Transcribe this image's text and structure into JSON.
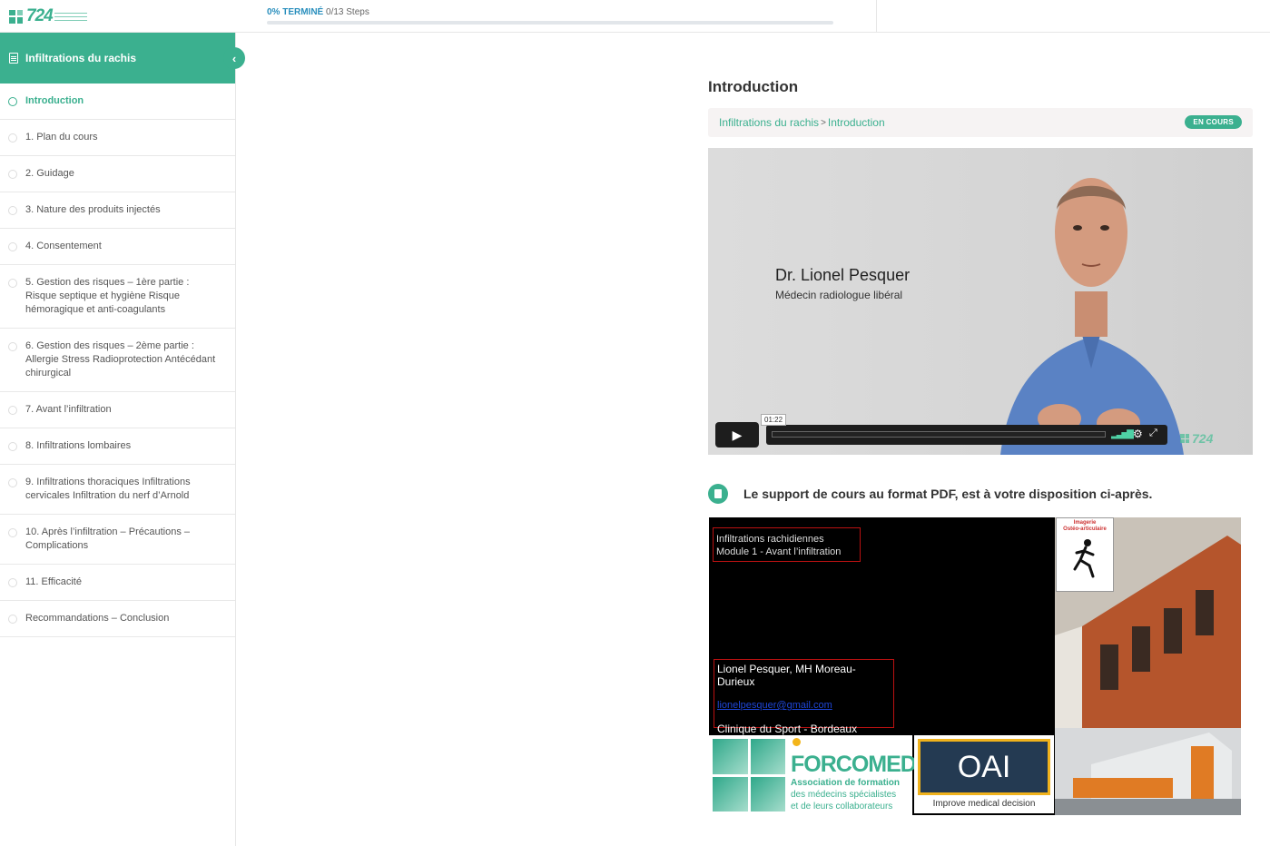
{
  "brand": {
    "logo_text": "724",
    "accent": "#3bb08f"
  },
  "progress": {
    "percent_label": "0% TERMINÉ",
    "steps_label": "0/13 Steps",
    "value": 0
  },
  "sidebar": {
    "course_title": "Infiltrations du rachis",
    "items": [
      {
        "label": "Introduction",
        "active": true
      },
      {
        "label": "1. Plan du cours"
      },
      {
        "label": "2. Guidage"
      },
      {
        "label": "3. Nature des produits injectés"
      },
      {
        "label": "4. Consentement"
      },
      {
        "label": "5. Gestion des risques – 1ère partie : Risque septique et hygiène Risque hémoragique et anti-coagulants"
      },
      {
        "label": "6. Gestion des risques – 2ème partie : Allergie Stress Radioprotection Antécédant chirurgical"
      },
      {
        "label": "7. Avant l’infiltration"
      },
      {
        "label": "8. Infiltrations lombaires"
      },
      {
        "label": "9. Infiltrations thoraciques Infiltrations cervicales Infiltration du nerf d’Arnold"
      },
      {
        "label": "10. Après l’infiltration – Précautions – Complications"
      },
      {
        "label": "11. Efficacité"
      },
      {
        "label": "Recommandations – Conclusion"
      }
    ]
  },
  "main": {
    "title": "Introduction",
    "breadcrumb": {
      "course": "Infiltrations du rachis",
      "separator": ">",
      "current": "Introduction"
    },
    "status_badge": "EN COURS",
    "video": {
      "speaker_name": "Dr. Lionel Pesquer",
      "speaker_role": "Médecin radiologue libéral",
      "time": "01:22",
      "watermark": "724"
    },
    "pdf_notice": "Le support de cours au format PDF, est à votre disposition ci-après.",
    "slide": {
      "title_line1": "Infiltrations rachidiennes",
      "title_line2": "Module 1 - Avant l’infiltration",
      "authors": "Lionel Pesquer, MH Moreau-Durieux",
      "email": "lionelpesquer@gmail.com",
      "place": "Clinique du Sport - Bordeaux",
      "imagerie_line1": "Imagerie",
      "imagerie_line2": "Ostéo-articulaire",
      "forcomed_name": "FORCOMED",
      "forcomed_sub1": "Association de formation",
      "forcomed_sub2": "des médecins spécialistes",
      "forcomed_sub3": "et de leurs collaborateurs",
      "oai_name": "OAI",
      "oai_tagline": "Improve medical decision"
    }
  }
}
